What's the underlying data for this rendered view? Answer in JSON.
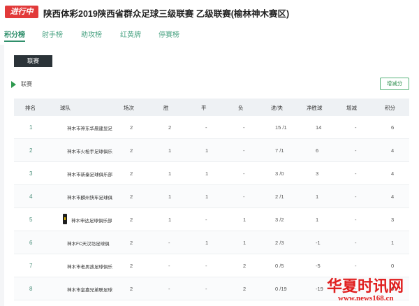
{
  "header": {
    "status_badge": "进行中",
    "title": "陕西体彩2019陕西省群众足球三级联赛 乙级联赛(榆林神木赛区)"
  },
  "tabs": [
    {
      "label": "积分榜",
      "active": true
    },
    {
      "label": "射手榜",
      "active": false
    },
    {
      "label": "助攻榜",
      "active": false
    },
    {
      "label": "红黄牌",
      "active": false
    },
    {
      "label": "停赛榜",
      "active": false
    }
  ],
  "league_button": "联赛",
  "section_label": "联赛",
  "flat_button": "增减分",
  "table": {
    "columns": [
      "排名",
      "球队",
      "场次",
      "胜",
      "平",
      "负",
      "进/失",
      "净胜球",
      "增减",
      "积分"
    ],
    "rows": [
      {
        "rank": "1",
        "team": "神木市神东华晨建显足",
        "played": "2",
        "won": "2",
        "drawn": "-",
        "lost": "-",
        "goals": "15 /1",
        "diff": "14",
        "adjust": "-",
        "points": "6"
      },
      {
        "rank": "2",
        "team": "神木市火枪手足球俱乐",
        "played": "2",
        "won": "1",
        "drawn": "1",
        "lost": "-",
        "goals": "7 /1",
        "diff": "6",
        "adjust": "-",
        "points": "4"
      },
      {
        "rank": "3",
        "team": "神木市新秦足球俱乐部",
        "played": "2",
        "won": "1",
        "drawn": "1",
        "lost": "-",
        "goals": "3 /0",
        "diff": "3",
        "adjust": "-",
        "points": "4"
      },
      {
        "rank": "4",
        "team": "神木市麟州快车足球俱",
        "played": "2",
        "won": "1",
        "drawn": "1",
        "lost": "-",
        "goals": "2 /1",
        "diff": "1",
        "adjust": "-",
        "points": "4"
      },
      {
        "rank": "5",
        "team": "神木申达足球俱乐部",
        "played": "2",
        "won": "1",
        "drawn": "-",
        "lost": "1",
        "goals": "3 /2",
        "diff": "1",
        "adjust": "-",
        "points": "3",
        "logo": true
      },
      {
        "rank": "6",
        "team": "神木FC天汉坊足球俱",
        "played": "2",
        "won": "-",
        "drawn": "1",
        "lost": "1",
        "goals": "2 /3",
        "diff": "-1",
        "adjust": "-",
        "points": "1"
      },
      {
        "rank": "7",
        "team": "神木市老男孩足球俱乐",
        "played": "2",
        "won": "-",
        "drawn": "-",
        "lost": "2",
        "goals": "0 /5",
        "diff": "-5",
        "adjust": "-",
        "points": "0"
      },
      {
        "rank": "8",
        "team": "神木市皇嘉兄弟联足球",
        "played": "2",
        "won": "-",
        "drawn": "-",
        "lost": "2",
        "goals": "0 /19",
        "diff": "-19",
        "adjust": "-",
        "points": "0"
      }
    ]
  },
  "watermark": {
    "name": "华夏时讯网",
    "url": "www.news168.cn"
  },
  "colors": {
    "badge_red": "#e23a3a",
    "accent_green": "#2f8f6b",
    "dark_button": "#2b3338"
  }
}
